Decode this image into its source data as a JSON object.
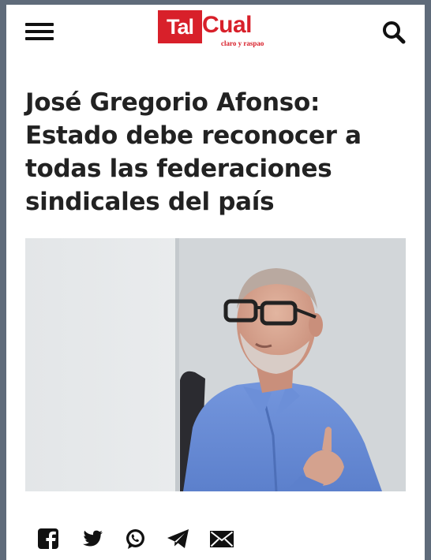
{
  "header": {
    "menu_icon": "hamburger-menu-icon",
    "logo": {
      "part1": "Tal",
      "part2": "Cual",
      "slogan": "claro y raspao"
    },
    "search_icon": "search-icon"
  },
  "article": {
    "headline": "José Gregorio Afonso: Estado debe reconocer a todas las federaciones sindicales del país"
  },
  "share": {
    "icons": [
      "facebook-icon",
      "twitter-icon",
      "whatsapp-icon",
      "telegram-icon",
      "email-icon"
    ]
  },
  "colors": {
    "brand_red": "#d8202a",
    "headline": "#222222",
    "frame": "#5f6b7a"
  }
}
